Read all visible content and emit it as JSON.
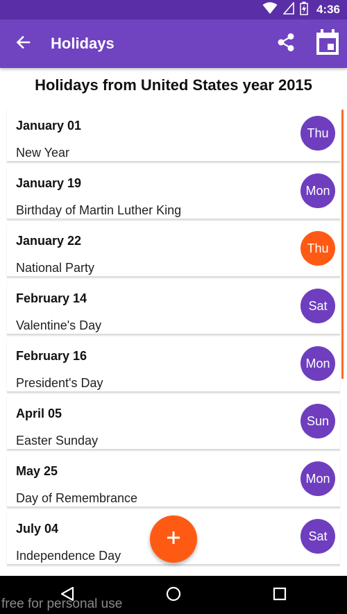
{
  "status_bar": {
    "time": "4:36",
    "icons": [
      "wifi-icon",
      "signal-icon",
      "battery-icon"
    ]
  },
  "app_bar": {
    "title": "Holidays",
    "back_icon": "arrow-back-icon",
    "share_icon": "share-icon",
    "calendar_icon": "calendar-icon"
  },
  "heading": "Holidays from United States year 2015",
  "holidays": [
    {
      "date": "January 01",
      "name": "New Year",
      "day": "Thu",
      "highlight": false
    },
    {
      "date": "January 19",
      "name": "Birthday of Martin Luther King",
      "day": "Mon",
      "highlight": false
    },
    {
      "date": "January 22",
      "name": "National Party",
      "day": "Thu",
      "highlight": true
    },
    {
      "date": "February 14",
      "name": "Valentine's Day",
      "day": "Sat",
      "highlight": false
    },
    {
      "date": "February 16",
      "name": "President's Day",
      "day": "Mon",
      "highlight": false
    },
    {
      "date": "April 05",
      "name": "Easter Sunday",
      "day": "Sun",
      "highlight": false
    },
    {
      "date": "May 25",
      "name": "Day of Remembrance",
      "day": "Mon",
      "highlight": false
    },
    {
      "date": "July 04",
      "name": "Independence Day",
      "day": "Sat",
      "highlight": false
    }
  ],
  "fab": {
    "icon": "plus-icon"
  },
  "nav_bar": {
    "icons": [
      "nav-back-icon",
      "home-icon",
      "recents-icon"
    ]
  },
  "watermark": "free for personal use",
  "colors": {
    "primary": "#7043c1",
    "primary_dark": "#5a2ea6",
    "accent": "#ff5a14",
    "badge": "#6e3ebf"
  }
}
